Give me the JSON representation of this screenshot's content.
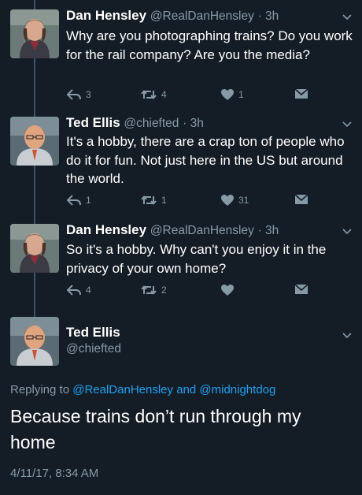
{
  "colors": {
    "background": "#141d26",
    "text_primary": "#ffffff",
    "text_secondary": "#8899a6",
    "link": "#1da1f2",
    "thread_line": "#3d5466"
  },
  "tweets": [
    {
      "display_name": "Dan Hensley",
      "handle": "@RealDanHensley",
      "time": "· 3h",
      "text": "Why are you photographing trains? Do you work for the rail company? Are you the media?",
      "replies": "3",
      "retweets": "4",
      "likes": "1",
      "avatar_icon": "dan-hensley-avatar"
    },
    {
      "display_name": "Ted Ellis",
      "handle": "@chiefted",
      "time": "· 3h",
      "text": "It's a hobby, there are a crap ton of people who do it for fun. Not just here in the US but around the world.",
      "replies": "1",
      "retweets": "1",
      "likes": "31",
      "avatar_icon": "ted-ellis-avatar"
    },
    {
      "display_name": "Dan Hensley",
      "handle": "@RealDanHensley",
      "time": "· 3h",
      "text": "So it's a hobby. Why can't you enjoy it in the privacy of your own home?",
      "replies": "4",
      "retweets": "2",
      "likes": "",
      "avatar_icon": "dan-hensley-avatar"
    }
  ],
  "focused": {
    "display_name": "Ted Ellis",
    "handle": "@chiefted",
    "replying_prefix": "Replying to",
    "replying_to_1": "@RealDanHensley",
    "replying_and": "and",
    "replying_to_2": "@midnightdog",
    "text": "Because trains don’t run through my home",
    "timestamp": "4/11/17, 8:34 AM",
    "avatar_icon": "ted-ellis-avatar"
  },
  "icons": {
    "reply": "reply-icon",
    "retweet": "retweet-icon",
    "like": "heart-icon",
    "dm": "envelope-icon",
    "more": "chevron-down-icon"
  }
}
